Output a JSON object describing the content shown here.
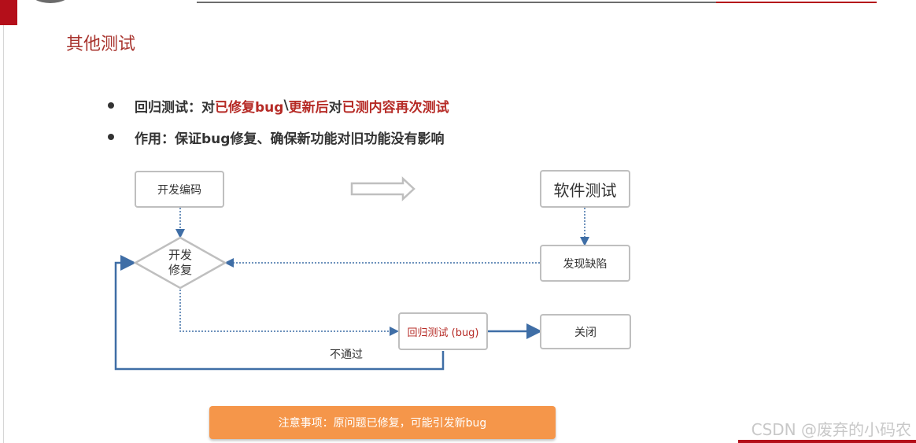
{
  "title": "其他测试",
  "bullets": [
    {
      "label": "回归测试：",
      "seg1": "对",
      "seg2": "已修复bug",
      "seg3": "\\",
      "seg4": "更新后",
      "seg5": "对",
      "seg6": "已测内容再次测试"
    },
    {
      "text": "作用：保证bug修复、确保新功能对旧功能没有影响"
    }
  ],
  "flow": {
    "dev_coding": "开发编码",
    "software_testing": "软件测试",
    "find_defect": "发现缺陷",
    "dev_fix_line1": "开发",
    "dev_fix_line2": "修复",
    "regression": "回归测试 (bug)",
    "close": "关闭",
    "not_passed": "不通过"
  },
  "note": "注意事项：原问题已修复，可能引发新bug",
  "watermark": "CSDN @废弃的小码农",
  "colors": {
    "accent_red": "#b62b26",
    "note_orange": "#f5964a",
    "flow_blue": "#3f6ea6",
    "box_border": "#bfbfbf"
  }
}
